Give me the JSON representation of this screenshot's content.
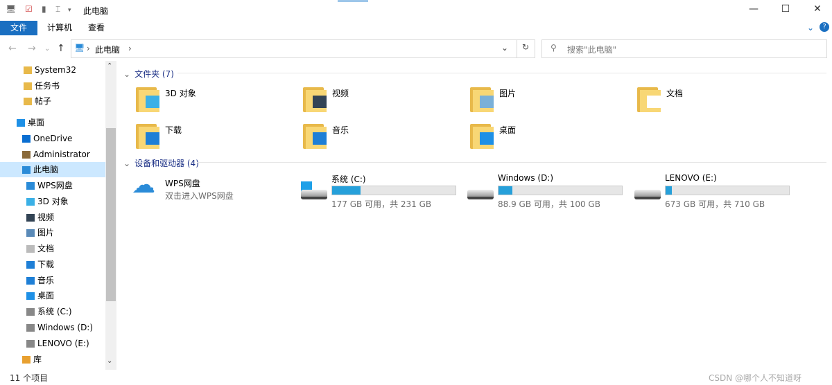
{
  "window": {
    "title": "此电脑",
    "controls": [
      "—",
      "☐",
      "✕"
    ]
  },
  "ribbon": {
    "tabs": [
      "文件",
      "计算机",
      "查看"
    ]
  },
  "address": {
    "path": [
      "此电脑"
    ],
    "search_placeholder": "搜索\"此电脑\""
  },
  "sidebar": {
    "items": [
      {
        "label": "System32",
        "icon": "folder-icon"
      },
      {
        "label": "任务书",
        "icon": "folder-icon"
      },
      {
        "label": "帖子",
        "icon": "folder-icon"
      },
      {
        "label": "桌面",
        "icon": "desktop-icon"
      },
      {
        "label": "OneDrive",
        "icon": "cloud-icon"
      },
      {
        "label": "Administrator",
        "icon": "user-icon"
      },
      {
        "label": "此电脑",
        "icon": "computer-icon",
        "selected": true
      },
      {
        "label": "WPS网盘",
        "icon": "wps-cloud-icon"
      },
      {
        "label": "3D 对象",
        "icon": "cube-icon"
      },
      {
        "label": "视频",
        "icon": "video-icon"
      },
      {
        "label": "图片",
        "icon": "picture-icon"
      },
      {
        "label": "文档",
        "icon": "document-icon"
      },
      {
        "label": "下载",
        "icon": "download-icon"
      },
      {
        "label": "音乐",
        "icon": "music-icon"
      },
      {
        "label": "桌面",
        "icon": "desktop-icon"
      },
      {
        "label": "系统 (C:)",
        "icon": "drive-icon"
      },
      {
        "label": "Windows (D:)",
        "icon": "drive-icon"
      },
      {
        "label": "LENOVO (E:)",
        "icon": "drive-icon"
      },
      {
        "label": "库",
        "icon": "library-icon"
      }
    ]
  },
  "folders_section": {
    "title": "文件夹 (7)",
    "items": [
      {
        "label": "3D 对象",
        "color": "#3ab0e6"
      },
      {
        "label": "视频",
        "color": "#334455"
      },
      {
        "label": "图片",
        "color": "#7ab0d8"
      },
      {
        "label": "文档",
        "color": "#ffffff"
      },
      {
        "label": "下载",
        "color": "#1e7fd6"
      },
      {
        "label": "音乐",
        "color": "#1e7fd6"
      },
      {
        "label": "桌面",
        "color": "#1e90e6"
      }
    ]
  },
  "devices_section": {
    "title": "设备和驱动器 (4)",
    "wps": {
      "name": "WPS网盘",
      "sub": "双击进入WPS网盘"
    },
    "drives": [
      {
        "name": "系统 (C:)",
        "sub": "177 GB 可用，共 231 GB",
        "used_percent": 23
      },
      {
        "name": "Windows (D:)",
        "sub": "88.9 GB 可用，共 100 GB",
        "used_percent": 11
      },
      {
        "name": "LENOVO (E:)",
        "sub": "673 GB 可用，共 710 GB",
        "used_percent": 5
      }
    ]
  },
  "status": {
    "count": "11 个项目"
  },
  "watermark": "CSDN @哪个人不知道呀"
}
